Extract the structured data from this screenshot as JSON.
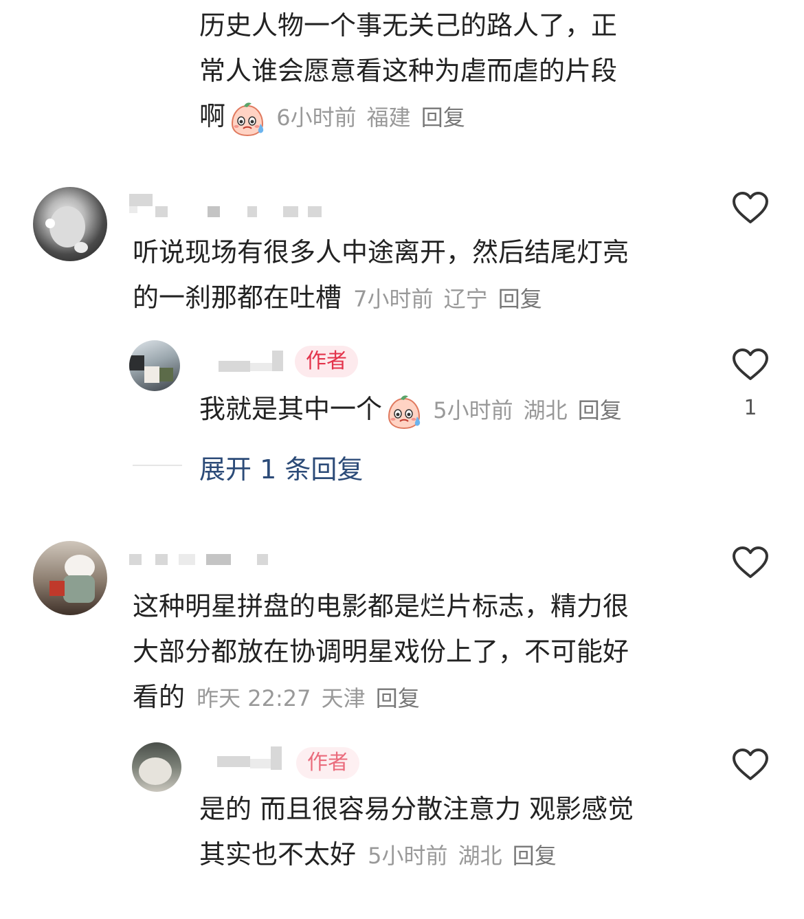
{
  "comment0": {
    "text_lines": [
      "历史人物一个事无关己的路人了，正",
      "常人谁会愿意看这种为虐而虐的片段",
      "啊"
    ],
    "emoji": "sweat-smile-emoji",
    "time": "6小时前",
    "location": "福建",
    "reply": "回复"
  },
  "comment1": {
    "text_lines": [
      "听说现场有很多人中途离开，然后结尾灯亮",
      "的一刹那都在吐槽"
    ],
    "time": "7小时前",
    "location": "辽宁",
    "reply": "回复",
    "author_reply": {
      "badge": "作者",
      "text": "我就是其中一个",
      "emoji": "sweat-smile-emoji",
      "time": "5小时前",
      "location": "湖北",
      "reply": "回复",
      "likes": "1"
    },
    "expand": "展开 1 条回复"
  },
  "comment2": {
    "text_lines": [
      "这种明星拼盘的电影都是烂片标志，精力很",
      "大部分都放在协调明星戏份上了，不可能好",
      "看的"
    ],
    "time": "昨天 22:27",
    "location": "天津",
    "reply": "回复",
    "author_reply": {
      "badge": "作者",
      "text_lines": [
        "是的 而且很容易分散注意力 观影感觉",
        "其实也不太好"
      ],
      "time": "5小时前",
      "location": "湖北",
      "reply": "回复"
    }
  },
  "colors": {
    "heart": "#333333",
    "badge_bg": "#fdeaed",
    "badge_fg": "#e3334b",
    "link": "#2c4b78",
    "meta": "#999999"
  }
}
